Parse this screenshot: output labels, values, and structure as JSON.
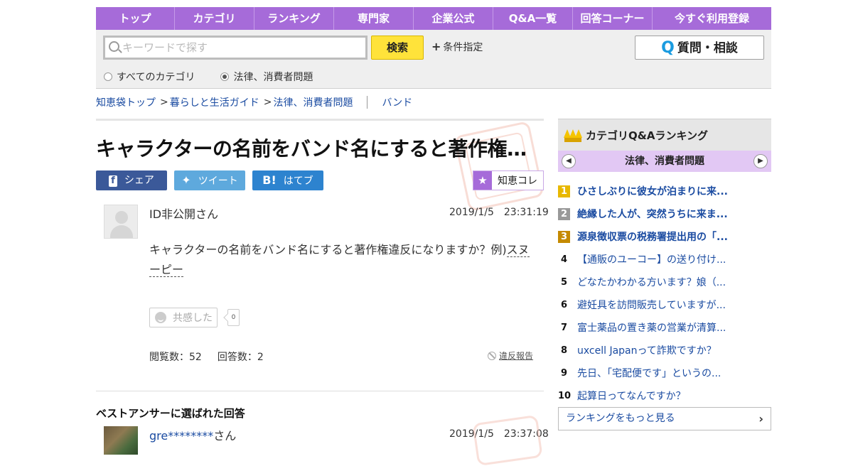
{
  "nav": {
    "items": [
      {
        "label": "トップ",
        "w": 111
      },
      {
        "label": "カテゴリ",
        "w": 112
      },
      {
        "label": "ランキング",
        "w": 112
      },
      {
        "label": "専門家",
        "w": 112
      },
      {
        "label": "企業公式",
        "w": 112
      },
      {
        "label": "Q&A一覧",
        "w": 112
      },
      {
        "label": "回答コーナー",
        "w": 112
      },
      {
        "label": "今すぐ利用登録",
        "w": 167
      }
    ]
  },
  "search": {
    "placeholder": "キーワードで探す",
    "button": "検索",
    "condition": "条件指定",
    "ask_button": "質問・相談",
    "scope_all": "すべてのカテゴリ",
    "scope_current": "法律、消費者問題"
  },
  "breadcrumb": {
    "top": "知恵袋トップ",
    "level1": "暮らしと生活ガイド",
    "level2": "法律、消費者問題",
    "tag": "バンド"
  },
  "question": {
    "title": "キャラクターの名前をバンド名にすると著作権…",
    "author": "ID非公開さん",
    "date": "2019/1/5　23:31:19",
    "body_before": "キャラクターの名前をバンド名にすると著作権違反になりますか？例)",
    "body_link": "スヌーピー",
    "empathy_label": "共感した",
    "empathy_count": "0",
    "views": "閲覧数：52",
    "answers": "回答数：2",
    "report": "違反報告"
  },
  "share": {
    "facebook": "シェア",
    "twitter": "ツイート",
    "hatena": "はてブ",
    "collect": "知恵コレ"
  },
  "best_answer": {
    "heading": "ベストアンサーに選ばれた回答",
    "author_id": "gre********",
    "author_suffix": "さん",
    "date": "2019/1/5　23:37:08"
  },
  "sidebar": {
    "title": "カテゴリQ&Aランキング",
    "category": "法律、消費者問題",
    "ranking": [
      {
        "rank": "1",
        "text": "ひさしぶりに彼女が泊まりに来...",
        "bold": true
      },
      {
        "rank": "2",
        "text": "絶縁した人が、突然うちに来ま...",
        "bold": true
      },
      {
        "rank": "3",
        "text": "源泉徴収票の税務署提出用の「...",
        "bold": true
      },
      {
        "rank": "4",
        "text": "【通販のユーコー】の送り付け...",
        "bold": false
      },
      {
        "rank": "5",
        "text": "どなたかわかる方います？娘（...",
        "bold": false
      },
      {
        "rank": "6",
        "text": "避妊具を訪問販売していますが...",
        "bold": false
      },
      {
        "rank": "7",
        "text": "富士薬品の置き薬の営業が清算...",
        "bold": false
      },
      {
        "rank": "8",
        "text": "uxcell Japanって詐欺ですか？",
        "bold": false
      },
      {
        "rank": "9",
        "text": "先日、「宅配便です」というの...",
        "bold": false
      },
      {
        "rank": "10",
        "text": "起算日ってなんですか？",
        "bold": false
      }
    ],
    "more": "ランキングをもっと見る"
  },
  "colors": {
    "nav_bg": "#a66bd9",
    "search_button": "#ffe33a",
    "link": "#1a4ba1",
    "facebook": "#3b5999",
    "twitter": "#5ea9dd",
    "hatena": "#2d83cf"
  }
}
